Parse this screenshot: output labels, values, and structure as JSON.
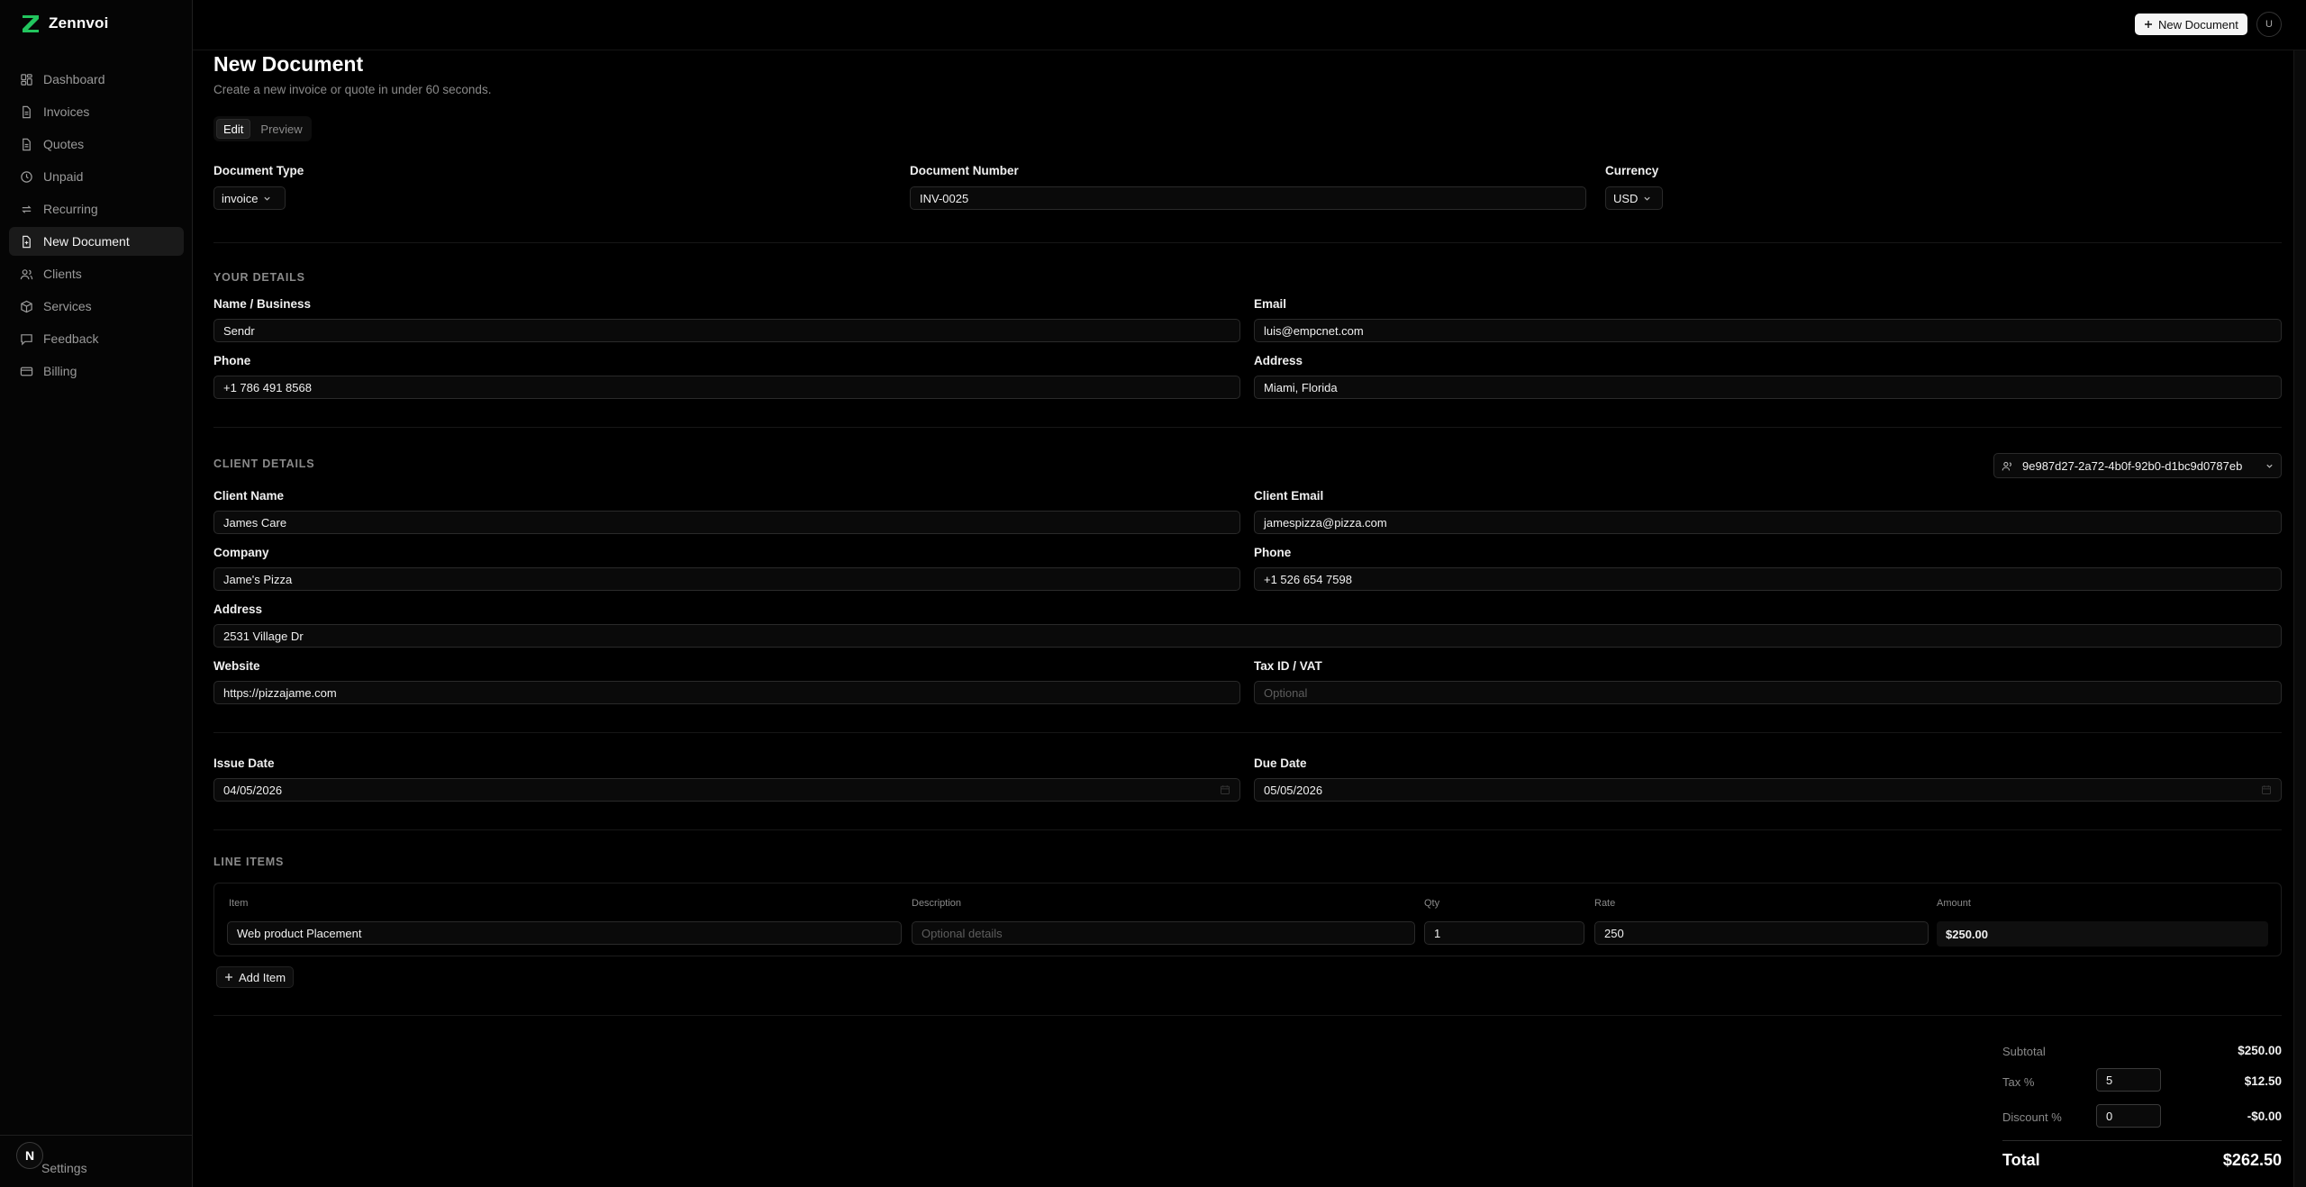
{
  "brand": {
    "name": "Zennvoi"
  },
  "sidebar": {
    "items": [
      {
        "label": "Dashboard",
        "icon": "dashboard-icon"
      },
      {
        "label": "Invoices",
        "icon": "file-icon"
      },
      {
        "label": "Quotes",
        "icon": "file-icon"
      },
      {
        "label": "Unpaid",
        "icon": "clock-icon"
      },
      {
        "label": "Recurring",
        "icon": "repeat-icon"
      },
      {
        "label": "New Document",
        "icon": "file-plus-icon",
        "active": true
      },
      {
        "label": "Clients",
        "icon": "users-icon"
      },
      {
        "label": "Services",
        "icon": "package-icon"
      },
      {
        "label": "Feedback",
        "icon": "message-icon"
      },
      {
        "label": "Billing",
        "icon": "credit-card-icon"
      }
    ],
    "settings_label": "Settings",
    "badge": "N"
  },
  "header": {
    "new_document_label": "New Document",
    "avatar_initial": "U"
  },
  "page": {
    "title": "New Document",
    "subtitle": "Create a new invoice or quote in under 60 seconds.",
    "tabs": [
      "Edit",
      "Preview"
    ]
  },
  "doc": {
    "type_label": "Document Type",
    "type_value": "invoice",
    "number_label": "Document Number",
    "number_value": "INV-0025",
    "currency_label": "Currency",
    "currency_value": "USD"
  },
  "your_details": {
    "title": "YOUR DETAILS",
    "name_label": "Name / Business",
    "name_value": "Sendr",
    "email_label": "Email",
    "email_value": "luis@empcnet.com",
    "phone_label": "Phone",
    "phone_value": "+1 786 491 8568",
    "address_label": "Address",
    "address_value": "Miami, Florida"
  },
  "client": {
    "title": "CLIENT DETAILS",
    "selector_value": "9e987d27-2a72-4b0f-92b0-d1bc9d0787eb",
    "name_label": "Client Name",
    "name_value": "James Care",
    "email_label": "Client Email",
    "email_value": "jamespizza@pizza.com",
    "company_label": "Company",
    "company_value": "Jame's Pizza",
    "phone_label": "Phone",
    "phone_value": "+1 526 654 7598",
    "address_label": "Address",
    "address_value": "2531 Village Dr",
    "website_label": "Website",
    "website_value": "https://pizzajame.com",
    "tax_label": "Tax ID / VAT",
    "tax_placeholder": "Optional"
  },
  "dates": {
    "issue_label": "Issue Date",
    "issue_value": "04/05/2026",
    "due_label": "Due Date",
    "due_value": "05/05/2026"
  },
  "line_items": {
    "title": "LINE ITEMS",
    "headers": {
      "item": "Item",
      "description": "Description",
      "qty": "Qty",
      "rate": "Rate",
      "amount": "Amount"
    },
    "rows": [
      {
        "item": "Web product Placement",
        "description_placeholder": "Optional details",
        "qty": "1",
        "rate": "250",
        "amount": "$250.00"
      }
    ],
    "add_label": "Add Item"
  },
  "totals": {
    "subtotal_label": "Subtotal",
    "subtotal_value": "$250.00",
    "tax_label": "Tax %",
    "tax_input": "5",
    "tax_value": "$12.50",
    "discount_label": "Discount %",
    "discount_input": "0",
    "discount_value": "-$0.00",
    "total_label": "Total",
    "total_value": "$262.50"
  }
}
